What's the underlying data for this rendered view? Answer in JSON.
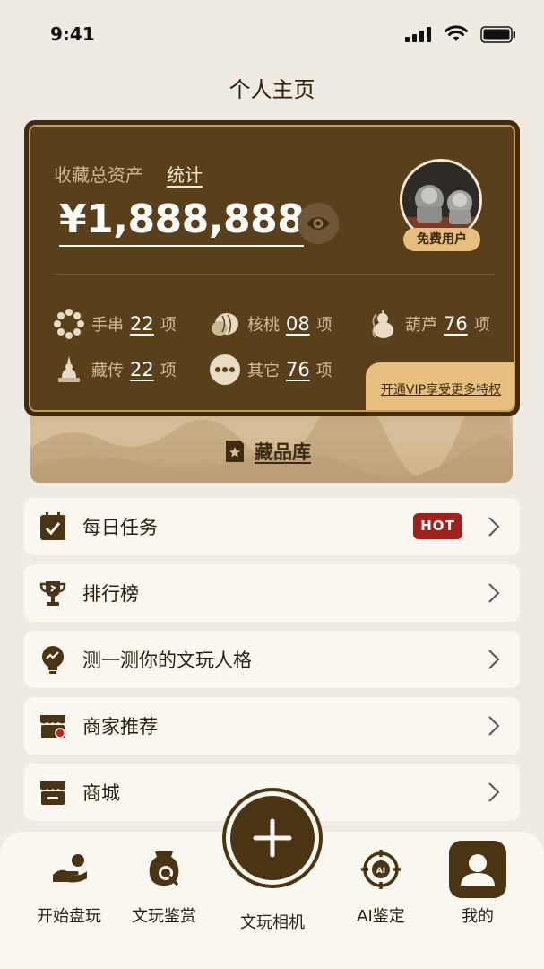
{
  "status_bar": {
    "time": "9:41"
  },
  "page": {
    "title": "个人主页"
  },
  "asset_card": {
    "label": "收藏总资产",
    "stats_link": "统计",
    "amount": "¥1,888,888",
    "user_tier": "免费用户",
    "categories": [
      {
        "name": "手串",
        "count": "22",
        "unit": "项",
        "icon": "bead-bracelet-icon"
      },
      {
        "name": "核桃",
        "count": "08",
        "unit": "项",
        "icon": "walnut-icon"
      },
      {
        "name": "葫芦",
        "count": "76",
        "unit": "项",
        "icon": "gourd-icon"
      },
      {
        "name": "藏传",
        "count": "22",
        "unit": "项",
        "icon": "stupa-icon"
      },
      {
        "name": "其它",
        "count": "76",
        "unit": "项",
        "icon": "more-dots-icon"
      }
    ],
    "vip_prompt": "开通VIP享受更多特权"
  },
  "vault": {
    "label": "藏品库"
  },
  "menu": [
    {
      "label": "每日任务",
      "badge": "HOT",
      "icon": "daily-task-icon"
    },
    {
      "label": "排行榜",
      "icon": "trophy-icon"
    },
    {
      "label": "测一测你的文玩人格",
      "icon": "personality-test-icon"
    },
    {
      "label": "商家推荐",
      "icon": "store-recommend-icon"
    },
    {
      "label": "商城",
      "icon": "mall-icon"
    }
  ],
  "bottom_nav": [
    {
      "label": "开始盘玩",
      "icon": "hand-play-icon"
    },
    {
      "label": "文玩鉴赏",
      "icon": "appreciate-icon"
    },
    {
      "label": "文玩相机",
      "icon": "plus-icon"
    },
    {
      "label": "AI鉴定",
      "icon": "ai-target-icon"
    },
    {
      "label": "我的",
      "icon": "user-icon"
    }
  ],
  "colors": {
    "brown_dark": "#3f2b10",
    "brown": "#5a3f1b",
    "gold": "#e7bf7e",
    "hot_red": "#a3201a",
    "bg": "#efebe3"
  }
}
